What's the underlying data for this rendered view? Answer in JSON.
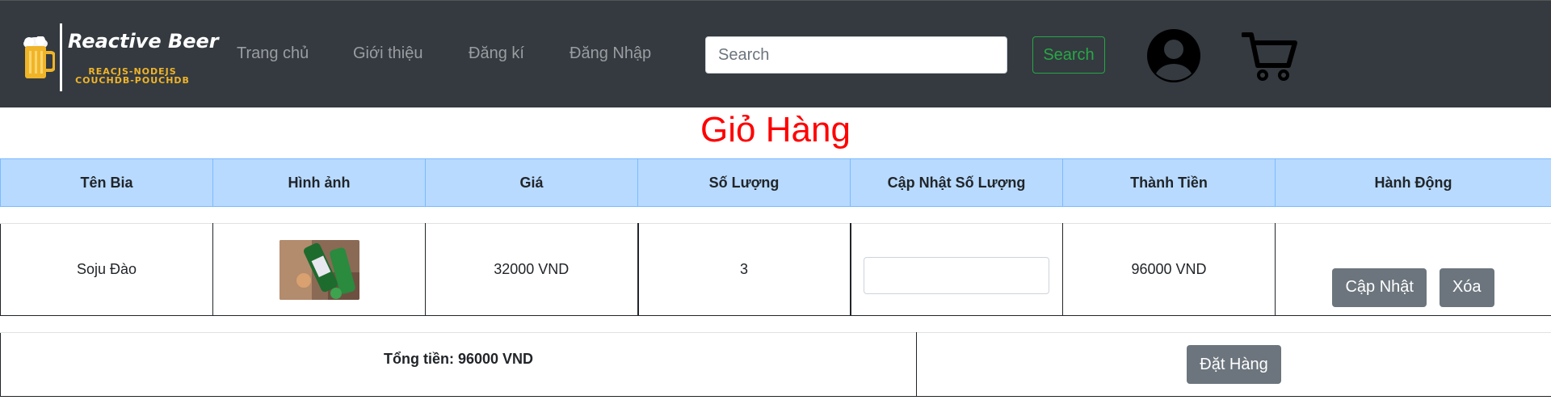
{
  "brand": {
    "name": "Reactive Beer",
    "tagline_1": "REACJS-NODEJS",
    "tagline_2": "COUCHDB-POUCHDB"
  },
  "nav": {
    "items": [
      {
        "label": "Trang chủ"
      },
      {
        "label": "Giới thiệu"
      },
      {
        "label": "Đăng kí"
      },
      {
        "label": "Đăng Nhập"
      }
    ],
    "search_placeholder": "Search",
    "search_button": "Search"
  },
  "page": {
    "title": "Giỏ Hàng"
  },
  "cart": {
    "columns": [
      "Tên Bia",
      "Hình ảnh",
      "Giá",
      "Số Lượng",
      "Cập Nhật Số Lượng",
      "Thành Tiền",
      "Hành Động"
    ],
    "items": [
      {
        "name": "Soju Đào",
        "image_alt": "soju-bottles-photo",
        "price": "32000 VND",
        "quantity": "3",
        "new_quantity": "",
        "subtotal": "96000 VND",
        "update_label": "Cập Nhật",
        "delete_label": "Xóa"
      }
    ],
    "total_text": "Tổng tiền: 96000 VND",
    "order_button": "Đặt Hàng"
  },
  "colors": {
    "navbar_bg": "#343a40",
    "title_red": "#ff0000",
    "header_bg": "#b8daff",
    "button_gray": "#6c757d",
    "search_green": "#28a745",
    "brand_yellow": "#f0b429"
  }
}
